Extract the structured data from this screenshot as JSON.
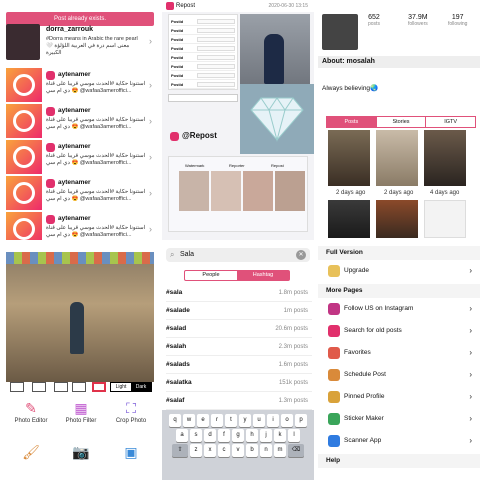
{
  "p1": {
    "toast": "Post already exists.",
    "feed_user": "dorra_zarrouk",
    "feed_caption": "#Dorra means in Arabic the rare pearl 🤍 معنی اسم درة في العربية اللؤلؤة الكبيرة",
    "rows": [
      {
        "user": "aytenamer",
        "caption": "استنونا حكاية #الحدث موسي قريبا على قناة دي ام سي 😍 @wafaa3ameroffici..."
      },
      {
        "user": "aytenamer",
        "caption": "استنونا حكاية #الحدث موسي قريبا على قناة دي ام سي 😍 @wafaa3ameroffici..."
      },
      {
        "user": "aytenamer",
        "caption": "استنونا حكاية #الحدث موسي قريبا على قناة دي ام سي 😍 @wafaa3ameroffici..."
      },
      {
        "user": "aytenamer",
        "caption": "استنونا حكاية #الحدث موسي قريبا على قناة دي ام سي 😍 @wafaa3ameroffici..."
      },
      {
        "user": "aytenamer",
        "caption": "استنونا حكاية #الحدث موسي قريبا على قناة دي ام سي 😍 @wafaa3ameroffici..."
      }
    ]
  },
  "p2": {
    "top_label": "Repost",
    "timestamp": "2020-06-30 13:15",
    "form_rows": [
      "Postid",
      "Postid",
      "Postid",
      "Postid",
      "Postid",
      "Postid",
      "Postid",
      "Postid"
    ],
    "repost_label": "@Repost",
    "thumb_tabs": [
      "Watermark",
      "Reporter",
      "Repost"
    ]
  },
  "p3": {
    "stats": [
      {
        "value": "652",
        "label": "posts"
      },
      {
        "value": "37.9M",
        "label": "followers"
      },
      {
        "value": "197",
        "label": "following"
      }
    ],
    "about": "About: mosalah",
    "bio": "Always believing🌏",
    "tabs": [
      "Posts",
      "Stories",
      "IGTV"
    ],
    "captions": [
      "2 days ago",
      "2 days ago",
      "4 days ago"
    ]
  },
  "p4": {
    "toggle": [
      "Light",
      "Dark"
    ],
    "tools": [
      {
        "label": "Photo Editor",
        "icon": "pencil-icon"
      },
      {
        "label": "Photo Filter",
        "icon": "filter-icon"
      },
      {
        "label": "Crop Photo",
        "icon": "crop-icon"
      }
    ]
  },
  "p5": {
    "search_value": "Sala",
    "segments": [
      "People",
      "Hashtag"
    ],
    "results": [
      {
        "tag": "#sala",
        "count": "1.8m posts"
      },
      {
        "tag": "#salade",
        "count": "1m posts"
      },
      {
        "tag": "#salad",
        "count": "20.6m posts"
      },
      {
        "tag": "#salah",
        "count": "2.3m posts"
      },
      {
        "tag": "#salads",
        "count": "1.6m posts"
      },
      {
        "tag": "#salatka",
        "count": "151k posts"
      },
      {
        "tag": "#salaf",
        "count": "1.3m posts"
      }
    ],
    "keys": [
      [
        "q",
        "w",
        "e",
        "r",
        "t",
        "y",
        "u",
        "i",
        "o",
        "p"
      ],
      [
        "a",
        "s",
        "d",
        "f",
        "g",
        "h",
        "j",
        "k",
        "l"
      ],
      [
        "z",
        "x",
        "c",
        "v",
        "b",
        "n",
        "m"
      ]
    ]
  },
  "p6": {
    "full_version": "Full Version",
    "upgrade": "Upgrade",
    "more_pages": "More Pages",
    "items": [
      {
        "label": "Follow US on Instagram",
        "color": "#c13584"
      },
      {
        "label": "Search for old posts",
        "color": "#e1306c"
      },
      {
        "label": "Favorites",
        "color": "#e05a4a"
      },
      {
        "label": "Schedule Post",
        "color": "#d98a3a"
      },
      {
        "label": "Pinned Profile",
        "color": "#d9a23a"
      },
      {
        "label": "Sticker Maker",
        "color": "#3aa55a"
      },
      {
        "label": "Scanner App",
        "color": "#2f7be0"
      }
    ],
    "help": "Help"
  }
}
